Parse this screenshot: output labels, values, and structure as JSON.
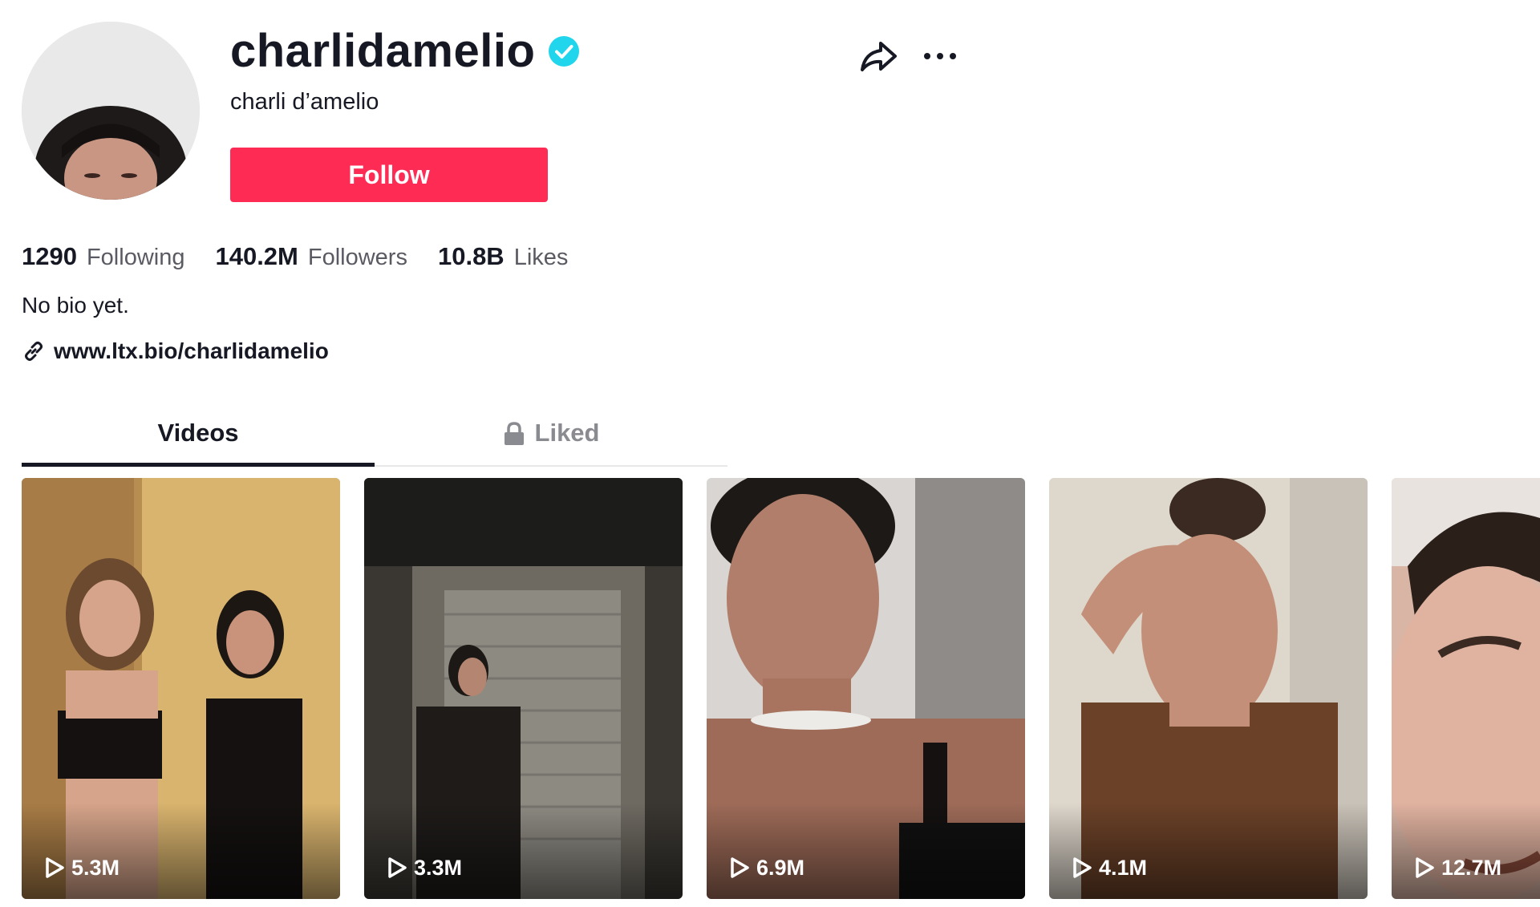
{
  "profile": {
    "username": "charlidamelio",
    "nickname": "charli d’amelio",
    "follow_label": "Follow",
    "bio": "No bio yet.",
    "link": "www.ltx.bio/charlidamelio",
    "verified_icon": "verified-badge-icon",
    "accent_color": "#fe2c55",
    "verified_color": "#20d5ec"
  },
  "stats": {
    "following_count": "1290",
    "following_label": "Following",
    "followers_count": "140.2M",
    "followers_label": "Followers",
    "likes_count": "10.8B",
    "likes_label": "Likes"
  },
  "actions": {
    "share_icon": "share-arrow-icon",
    "more_icon": "more-dots-icon"
  },
  "tabs": [
    {
      "label": "Videos",
      "active": true
    },
    {
      "label": "Liked",
      "active": false,
      "icon": "lock-icon"
    }
  ],
  "videos": [
    {
      "views": "5.3M"
    },
    {
      "views": "3.3M"
    },
    {
      "views": "6.9M"
    },
    {
      "views": "4.1M"
    },
    {
      "views": "12.7M"
    }
  ]
}
